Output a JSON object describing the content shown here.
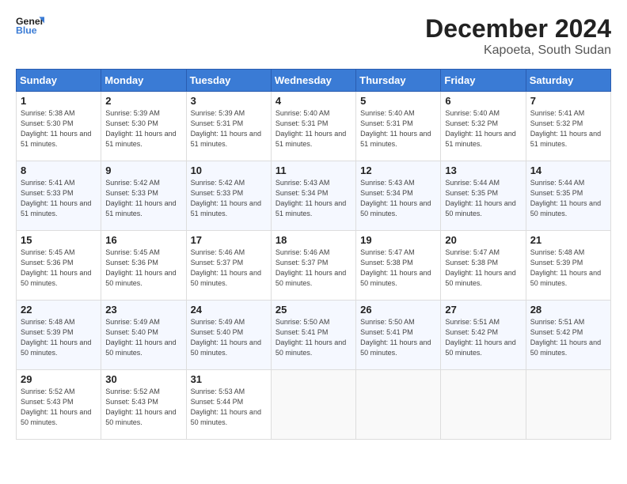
{
  "logo": {
    "line1": "General",
    "line2": "Blue"
  },
  "title": "December 2024",
  "subtitle": "Kapoeta, South Sudan",
  "weekdays": [
    "Sunday",
    "Monday",
    "Tuesday",
    "Wednesday",
    "Thursday",
    "Friday",
    "Saturday"
  ],
  "weeks": [
    [
      {
        "day": 1,
        "sunrise": "5:38 AM",
        "sunset": "5:30 PM",
        "daylight": "11 hours and 51 minutes."
      },
      {
        "day": 2,
        "sunrise": "5:39 AM",
        "sunset": "5:30 PM",
        "daylight": "11 hours and 51 minutes."
      },
      {
        "day": 3,
        "sunrise": "5:39 AM",
        "sunset": "5:31 PM",
        "daylight": "11 hours and 51 minutes."
      },
      {
        "day": 4,
        "sunrise": "5:40 AM",
        "sunset": "5:31 PM",
        "daylight": "11 hours and 51 minutes."
      },
      {
        "day": 5,
        "sunrise": "5:40 AM",
        "sunset": "5:31 PM",
        "daylight": "11 hours and 51 minutes."
      },
      {
        "day": 6,
        "sunrise": "5:40 AM",
        "sunset": "5:32 PM",
        "daylight": "11 hours and 51 minutes."
      },
      {
        "day": 7,
        "sunrise": "5:41 AM",
        "sunset": "5:32 PM",
        "daylight": "11 hours and 51 minutes."
      }
    ],
    [
      {
        "day": 8,
        "sunrise": "5:41 AM",
        "sunset": "5:33 PM",
        "daylight": "11 hours and 51 minutes."
      },
      {
        "day": 9,
        "sunrise": "5:42 AM",
        "sunset": "5:33 PM",
        "daylight": "11 hours and 51 minutes."
      },
      {
        "day": 10,
        "sunrise": "5:42 AM",
        "sunset": "5:33 PM",
        "daylight": "11 hours and 51 minutes."
      },
      {
        "day": 11,
        "sunrise": "5:43 AM",
        "sunset": "5:34 PM",
        "daylight": "11 hours and 51 minutes."
      },
      {
        "day": 12,
        "sunrise": "5:43 AM",
        "sunset": "5:34 PM",
        "daylight": "11 hours and 50 minutes."
      },
      {
        "day": 13,
        "sunrise": "5:44 AM",
        "sunset": "5:35 PM",
        "daylight": "11 hours and 50 minutes."
      },
      {
        "day": 14,
        "sunrise": "5:44 AM",
        "sunset": "5:35 PM",
        "daylight": "11 hours and 50 minutes."
      }
    ],
    [
      {
        "day": 15,
        "sunrise": "5:45 AM",
        "sunset": "5:36 PM",
        "daylight": "11 hours and 50 minutes."
      },
      {
        "day": 16,
        "sunrise": "5:45 AM",
        "sunset": "5:36 PM",
        "daylight": "11 hours and 50 minutes."
      },
      {
        "day": 17,
        "sunrise": "5:46 AM",
        "sunset": "5:37 PM",
        "daylight": "11 hours and 50 minutes."
      },
      {
        "day": 18,
        "sunrise": "5:46 AM",
        "sunset": "5:37 PM",
        "daylight": "11 hours and 50 minutes."
      },
      {
        "day": 19,
        "sunrise": "5:47 AM",
        "sunset": "5:38 PM",
        "daylight": "11 hours and 50 minutes."
      },
      {
        "day": 20,
        "sunrise": "5:47 AM",
        "sunset": "5:38 PM",
        "daylight": "11 hours and 50 minutes."
      },
      {
        "day": 21,
        "sunrise": "5:48 AM",
        "sunset": "5:39 PM",
        "daylight": "11 hours and 50 minutes."
      }
    ],
    [
      {
        "day": 22,
        "sunrise": "5:48 AM",
        "sunset": "5:39 PM",
        "daylight": "11 hours and 50 minutes."
      },
      {
        "day": 23,
        "sunrise": "5:49 AM",
        "sunset": "5:40 PM",
        "daylight": "11 hours and 50 minutes."
      },
      {
        "day": 24,
        "sunrise": "5:49 AM",
        "sunset": "5:40 PM",
        "daylight": "11 hours and 50 minutes."
      },
      {
        "day": 25,
        "sunrise": "5:50 AM",
        "sunset": "5:41 PM",
        "daylight": "11 hours and 50 minutes."
      },
      {
        "day": 26,
        "sunrise": "5:50 AM",
        "sunset": "5:41 PM",
        "daylight": "11 hours and 50 minutes."
      },
      {
        "day": 27,
        "sunrise": "5:51 AM",
        "sunset": "5:42 PM",
        "daylight": "11 hours and 50 minutes."
      },
      {
        "day": 28,
        "sunrise": "5:51 AM",
        "sunset": "5:42 PM",
        "daylight": "11 hours and 50 minutes."
      }
    ],
    [
      {
        "day": 29,
        "sunrise": "5:52 AM",
        "sunset": "5:43 PM",
        "daylight": "11 hours and 50 minutes."
      },
      {
        "day": 30,
        "sunrise": "5:52 AM",
        "sunset": "5:43 PM",
        "daylight": "11 hours and 50 minutes."
      },
      {
        "day": 31,
        "sunrise": "5:53 AM",
        "sunset": "5:44 PM",
        "daylight": "11 hours and 50 minutes."
      },
      null,
      null,
      null,
      null
    ]
  ]
}
